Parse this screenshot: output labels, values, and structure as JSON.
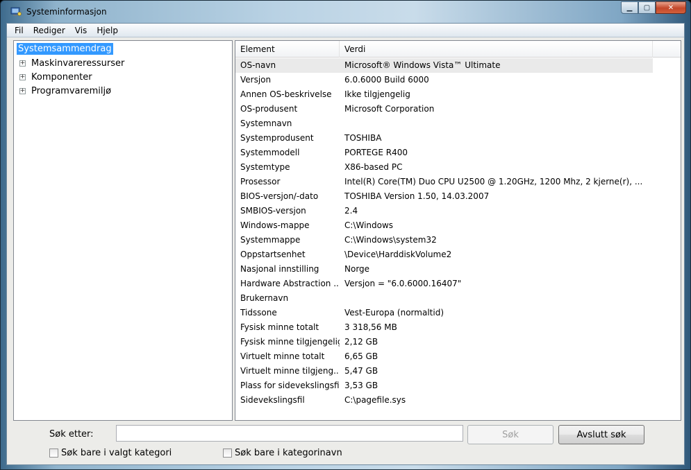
{
  "window": {
    "title": "Systeminformasjon"
  },
  "menu": [
    "Fil",
    "Rediger",
    "Vis",
    "Hjelp"
  ],
  "tree": {
    "root": "Systemsammendrag",
    "nodes": [
      "Maskinvareressurser",
      "Komponenter",
      "Programvaremiljø"
    ]
  },
  "list": {
    "headers": {
      "element": "Element",
      "value": "Verdi"
    },
    "rows": [
      {
        "element": "OS-navn",
        "value": "Microsoft® Windows Vista™ Ultimate"
      },
      {
        "element": "Versjon",
        "value": "6.0.6000 Build 6000"
      },
      {
        "element": "Annen OS-beskrivelse",
        "value": "Ikke tilgjengelig"
      },
      {
        "element": "OS-produsent",
        "value": "Microsoft Corporation"
      },
      {
        "element": "Systemnavn",
        "value": ""
      },
      {
        "element": "Systemprodusent",
        "value": "TOSHIBA"
      },
      {
        "element": "Systemmodell",
        "value": "PORTEGE R400"
      },
      {
        "element": "Systemtype",
        "value": "X86-based PC"
      },
      {
        "element": "Prosessor",
        "value": "Intel(R) Core(TM) Duo CPU      U2500  @ 1.20GHz, 1200 Mhz, 2 kjerne(r), ..."
      },
      {
        "element": "BIOS-versjon/-dato",
        "value": "TOSHIBA Version 1.50, 14.03.2007"
      },
      {
        "element": "SMBIOS-versjon",
        "value": "2.4"
      },
      {
        "element": "Windows-mappe",
        "value": "C:\\Windows"
      },
      {
        "element": "Systemmappe",
        "value": "C:\\Windows\\system32"
      },
      {
        "element": "Oppstartsenhet",
        "value": "\\Device\\HarddiskVolume2"
      },
      {
        "element": "Nasjonal innstilling",
        "value": "Norge"
      },
      {
        "element": "Hardware Abstraction ...",
        "value": "Versjon = \"6.0.6000.16407\""
      },
      {
        "element": "Brukernavn",
        "value": ""
      },
      {
        "element": "Tidssone",
        "value": "Vest-Europa (normaltid)"
      },
      {
        "element": "Fysisk minne totalt",
        "value": "3 318,56 MB"
      },
      {
        "element": "Fysisk minne tilgjengelig",
        "value": "2,12 GB"
      },
      {
        "element": "Virtuelt minne totalt",
        "value": "6,65 GB"
      },
      {
        "element": "Virtuelt minne tilgjeng...",
        "value": "5,47 GB"
      },
      {
        "element": "Plass for sidevekslingsfil",
        "value": "3,53 GB"
      },
      {
        "element": "Sidevekslingsfil",
        "value": "C:\\pagefile.sys"
      }
    ]
  },
  "search": {
    "label": "Søk etter:",
    "value": "",
    "search_button": "Søk",
    "stop_button": "Avslutt søk",
    "check_category": "Søk bare i valgt kategori",
    "check_category_names": "Søk bare i kategorinavn"
  }
}
